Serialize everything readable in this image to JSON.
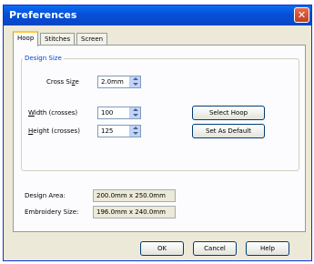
{
  "window": {
    "title": "Preferences",
    "close_glyph": "✕"
  },
  "tabs": [
    "Hoop",
    "Stitches",
    "Screen"
  ],
  "design_size": {
    "group_label": "Design Size",
    "cross_size": {
      "label": "Cross Size",
      "underline": "z",
      "value": "2.0mm"
    },
    "width": {
      "label": "Width (crosses)",
      "underline": "W",
      "value": "100"
    },
    "height": {
      "label": "Height (crosses)",
      "underline": "H",
      "value": "125"
    }
  },
  "buttons": {
    "select_hoop": "Select Hoop",
    "set_default": "Set As Default"
  },
  "info": {
    "design_area_label": "Design Area:",
    "design_area_value": "200.0mm x 250.0mm",
    "embroidery_size_label": "Embroidery Size:",
    "embroidery_size_value": "196.0mm x 240.0mm"
  },
  "footer": {
    "ok": "OK",
    "cancel": "Cancel",
    "help": "Help"
  }
}
